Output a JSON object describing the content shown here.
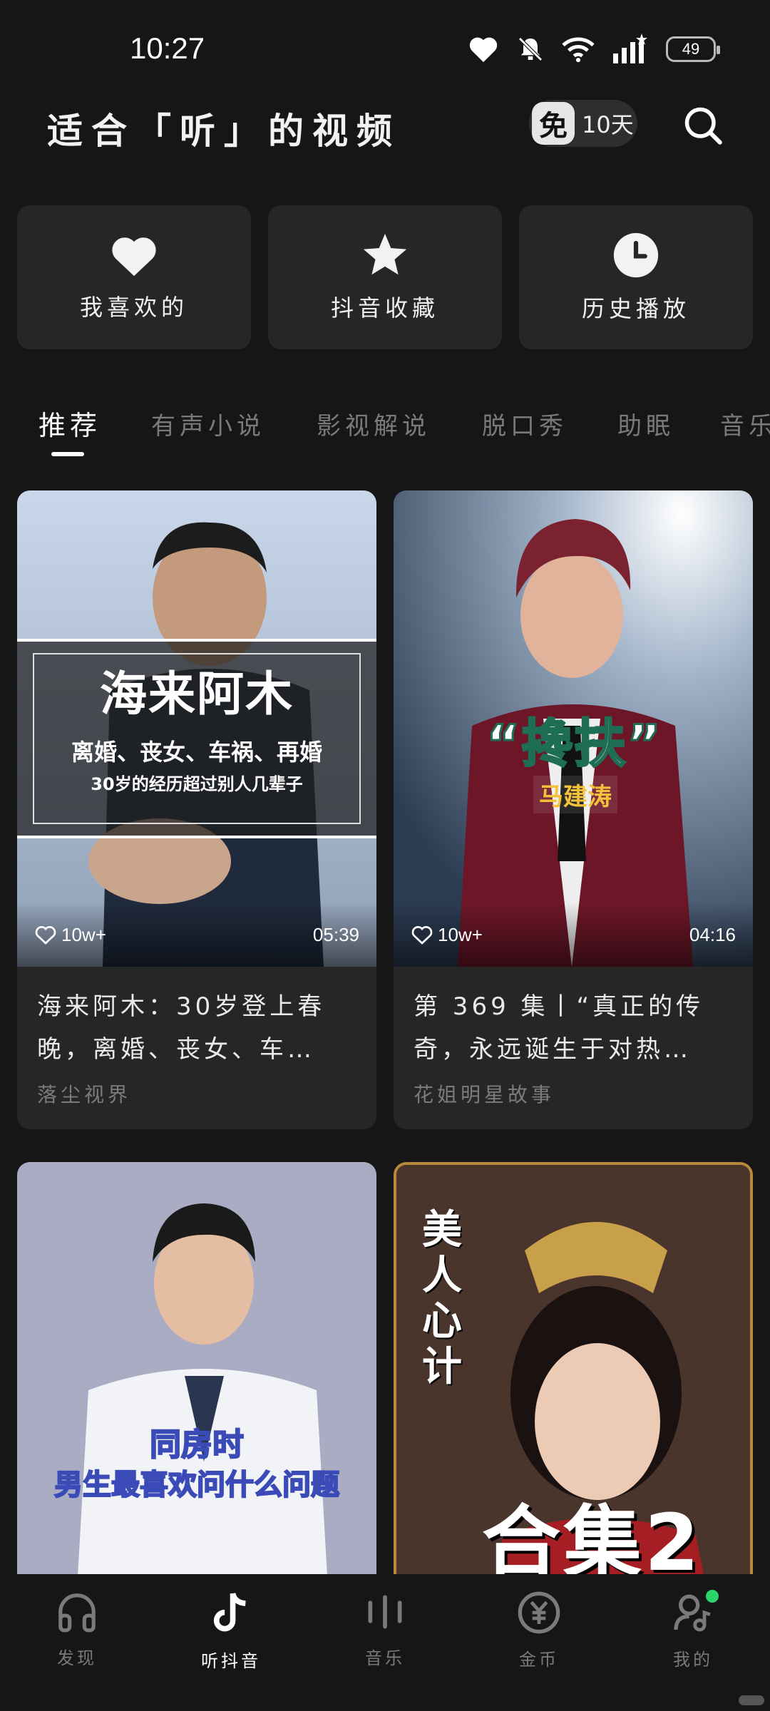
{
  "status_bar": {
    "time": "10:27",
    "battery": "49"
  },
  "header": {
    "title": "适合「听」的视频",
    "free_icon": "免",
    "free_days": "10天"
  },
  "quick_entries": [
    {
      "label": "我喜欢的",
      "icon": "heart-icon"
    },
    {
      "label": "抖音收藏",
      "icon": "star-icon"
    },
    {
      "label": "历史播放",
      "icon": "clock-icon"
    }
  ],
  "tabs": [
    {
      "label": "推荐",
      "active": true
    },
    {
      "label": "有声小说"
    },
    {
      "label": "影视解说"
    },
    {
      "label": "脱口秀"
    },
    {
      "label": "助眠"
    },
    {
      "label": "音乐"
    }
  ],
  "cards": [
    {
      "title": "海来阿木：30岁登上春晚，离婚、丧女、车…",
      "author": "落尘视界",
      "likes": "10w+",
      "duration": "05:39",
      "overlay": {
        "title": "海来阿木",
        "sub1": "离婚、丧女、车祸、再婚",
        "sub2": "30岁的经历超过别人几辈子"
      }
    },
    {
      "title": "第 369 集丨“真正的传奇，永远诞生于对热…",
      "author": "花姐明星故事",
      "likes": "10w+",
      "duration": "04:16",
      "overlay": {
        "title": "“搀扶”",
        "name": "马建涛"
      }
    },
    {
      "overlay": {
        "line1": "同房时",
        "line2": "男生最喜欢问什么问题"
      }
    },
    {
      "overlay": {
        "vertical": "美人心计",
        "bottom": "合集2"
      }
    }
  ],
  "bottom_nav": [
    {
      "label": "发现",
      "icon": "headphones-icon"
    },
    {
      "label": "听抖音",
      "icon": "tiktok-icon",
      "active": true
    },
    {
      "label": "音乐",
      "icon": "bars-icon"
    },
    {
      "label": "金币",
      "icon": "coin-icon"
    },
    {
      "label": "我的",
      "icon": "profile-icon"
    }
  ],
  "colors": {
    "background": "#161616",
    "card": "#262626",
    "active_text": "#ffffff",
    "inactive_text": "#7a7a7a",
    "dot": "#2bd46b"
  }
}
